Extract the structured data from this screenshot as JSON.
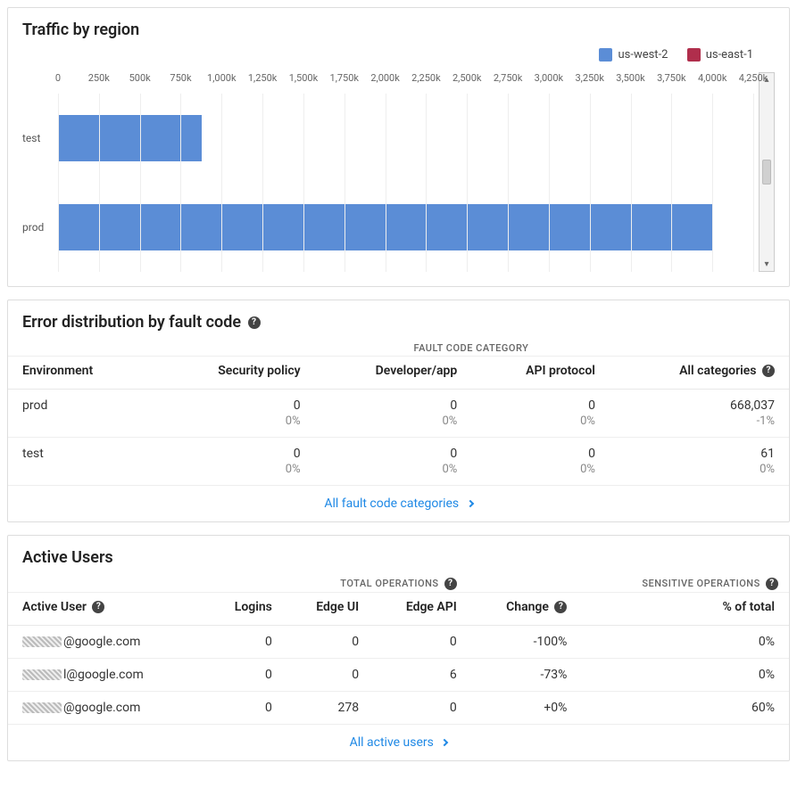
{
  "chart_data": {
    "type": "bar",
    "orientation": "horizontal",
    "title": "Traffic by region",
    "xlabel": "",
    "ylabel": "",
    "xlim": [
      0,
      4250000
    ],
    "categories": [
      "test",
      "prod"
    ],
    "series": [
      {
        "name": "us-west-2",
        "color": "#5b8dd6",
        "values": [
          880000,
          4000000
        ]
      },
      {
        "name": "us-east-1",
        "color": "#b02e4c",
        "values": [
          0,
          0
        ]
      }
    ],
    "x_ticks": [
      0,
      250000,
      500000,
      750000,
      1000000,
      1250000,
      1500000,
      1750000,
      2000000,
      2250000,
      2500000,
      2750000,
      3000000,
      3250000,
      3500000,
      3750000,
      4000000,
      4250000
    ],
    "x_tick_labels": [
      "0",
      "250k",
      "500k",
      "750k",
      "1,000k",
      "1,250k",
      "1,500k",
      "1,750k",
      "2,000k",
      "2,250k",
      "2,500k",
      "2,750k",
      "3,000k",
      "3,250k",
      "3,500k",
      "3,750k",
      "4,000k",
      "4,250k"
    ]
  },
  "error_panel": {
    "title": "Error distribution by fault code",
    "group_header": "FAULT CODE CATEGORY",
    "columns": {
      "env": "Environment",
      "security": "Security policy",
      "devapp": "Developer/app",
      "api": "API protocol",
      "all": "All categories"
    },
    "rows": [
      {
        "env": "prod",
        "security": "0",
        "security_pct": "0%",
        "devapp": "0",
        "devapp_pct": "0%",
        "api": "0",
        "api_pct": "0%",
        "all": "668,037",
        "all_pct": "-1%"
      },
      {
        "env": "test",
        "security": "0",
        "security_pct": "0%",
        "devapp": "0",
        "devapp_pct": "0%",
        "api": "0",
        "api_pct": "0%",
        "all": "61",
        "all_pct": "0%"
      }
    ],
    "footer_link": "All fault code categories"
  },
  "users_panel": {
    "title": "Active Users",
    "group_headers": {
      "total": "TOTAL OPERATIONS",
      "sensitive": "SENSITIVE OPERATIONS"
    },
    "columns": {
      "user": "Active User",
      "logins": "Logins",
      "edge_ui": "Edge UI",
      "edge_api": "Edge API",
      "change": "Change",
      "pct_total": "% of total"
    },
    "rows": [
      {
        "user_suffix": "@google.com",
        "logins": "0",
        "edge_ui": "0",
        "edge_api": "0",
        "change": "-100%",
        "pct_total": "0%"
      },
      {
        "user_suffix": "l@google.com",
        "logins": "0",
        "edge_ui": "0",
        "edge_api": "6",
        "change": "-73%",
        "pct_total": "0%"
      },
      {
        "user_suffix": "@google.com",
        "logins": "0",
        "edge_ui": "278",
        "edge_api": "0",
        "change": "+0%",
        "pct_total": "60%"
      }
    ],
    "footer_link": "All active users"
  }
}
